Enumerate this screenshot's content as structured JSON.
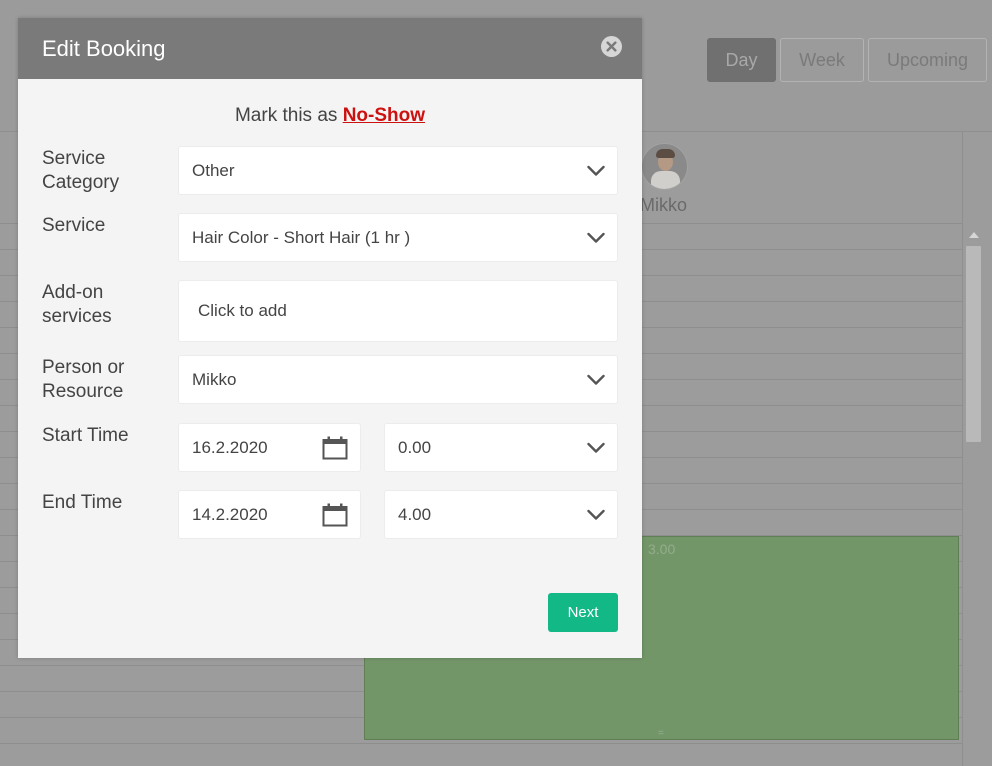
{
  "view_switch": {
    "day": "Day",
    "week": "Week",
    "upcoming": "Upcoming",
    "active": "Day"
  },
  "calendar": {
    "staff_name": "Mikko",
    "booking": {
      "time_label": "3.00",
      "handle": "=",
      "color": "#739669"
    }
  },
  "modal": {
    "title": "Edit Booking",
    "noshow_prefix": "Mark this as",
    "noshow_link": "No-Show",
    "fields": {
      "service_category": {
        "label": "Service Category",
        "value": "Other"
      },
      "service": {
        "label": "Service",
        "value": "Hair Color - Short Hair (1 hr )"
      },
      "addon": {
        "label": "Add-on services",
        "placeholder": "Click to add"
      },
      "person": {
        "label": "Person or Resource",
        "value": "Mikko"
      },
      "start": {
        "label": "Start Time",
        "date": "16.2.2020",
        "time": "0.00"
      },
      "end": {
        "label": "End Time",
        "date": "14.2.2020",
        "time": "4.00"
      }
    },
    "next_label": "Next",
    "accent_color": "#12b886",
    "link_color": "#cc1111"
  },
  "icons": [
    "close-icon",
    "chevron-down-icon",
    "calendar-icon",
    "scroll-up-arrow-icon"
  ]
}
